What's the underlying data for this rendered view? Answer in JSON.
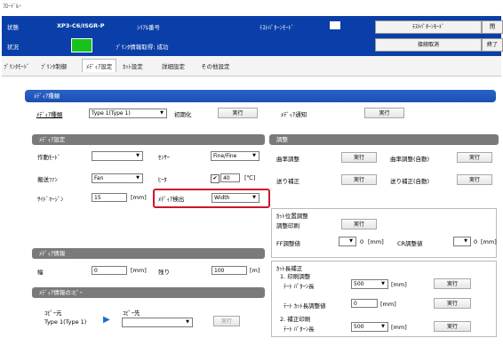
{
  "window": {
    "title": "ﾌﾛｰﾄﾞﾙｰ"
  },
  "header": {
    "row1_label": "状態",
    "model_name": "XP3-C6/ISGR-P",
    "serial_label": "ｼﾘｱﾙ番号",
    "mode_label": "ﾃｽﾄﾊﾟﾀｰﾝﾓｰﾄﾞ",
    "mode_button": "ﾃｽﾄﾊﾟﾀｰﾝﾓｰﾄﾞ",
    "close_button": "閉",
    "row2_label": "状況",
    "status_text": "ﾌﾟﾘﾝﾀ情報取得: 成功",
    "cancel_button": "接続取消",
    "exit_button": "終了",
    "status_color": "#16c21e"
  },
  "tabs": [
    "ﾌﾟﾘﾝﾀﾓｰﾄﾞ",
    "ﾌﾟﾘﾝﾀ制御",
    "ﾒﾃﾞｨｱ設定",
    "ｶｯﾄ設定",
    "詳細設定",
    "その他設定"
  ],
  "media_type": {
    "bar": "ﾒﾃﾞｨｱ種類",
    "label": "ﾒﾃﾞｨｱ種類",
    "value": "Type 1(Type 1)",
    "init_label": "初期化",
    "exec": "実行",
    "notify_label": "ﾒﾃﾞｨｱ通知",
    "exec2": "実行"
  },
  "media_settings": {
    "bar": "ﾒﾃﾞｨｱ設定",
    "mode_label": "作動ﾓｰﾄﾞ",
    "mode_value": "",
    "sensor_label": "ｾﾝｻｰ",
    "sensor_value": "Fine/Fine",
    "feed_label": "搬送ﾌｧﾝ",
    "feed_value": "Fan",
    "heater_label": "ﾋｰﾀ",
    "heater_value": "40",
    "heater_unit": "[℃]",
    "margin_label": "ｻｲﾄﾞﾏｰｼﾞﾝ",
    "margin_value": "15",
    "margin_unit": "[mm]",
    "detect_label": "ﾒﾃﾞｨｱ検出",
    "detect_value": "Width"
  },
  "adjust": {
    "bar": "調整",
    "row1_label": "曲率調整",
    "row1_exec": "実行",
    "row1_auto_label": "曲率調整(自動)",
    "row1_auto_exec": "実行",
    "row2_label": "送り補正",
    "row2_exec": "実行",
    "row2_auto_label": "送り補正(自動)",
    "row2_auto_exec": "実行"
  },
  "cut_position": {
    "title": "ｶｯﾄ位置調整",
    "row1_label": "調整印刷",
    "row1_exec": "実行",
    "ff_label": "FF調整値",
    "ff_value": "0",
    "ff_unit": "[mm]",
    "cr_label": "CR調整値",
    "cr_value": "0",
    "cr_unit": "[mm]"
  },
  "media_info": {
    "bar": "ﾒﾃﾞｨｱ情報",
    "width_label": "幅",
    "width_value": "0",
    "width_unit": "[mm]",
    "remain_label": "残り",
    "remain_value": "100",
    "remain_unit": "[m]"
  },
  "cut_correct": {
    "title": "ｶｯﾄ長補正",
    "s1_title": "1. 印刷調整",
    "s1_row_label": "ﾃｰﾄ ﾊﾟﾀｰﾝ長",
    "s1_row_value": "500",
    "s1_row_unit": "[mm]",
    "s1_exec": "実行",
    "s2_row_label": "ﾃｰﾄ ｶｯﾄ長調整値",
    "s2_row_value": "0",
    "s2_row_unit": "[mm]",
    "s2_exec": "実行",
    "s3_title": "2. 補正印刷",
    "s3_row_label": "ﾃｰﾄ ﾊﾟﾀｰﾝ長",
    "s3_row_value": "500",
    "s3_row_unit": "[mm]",
    "s3_exec": "実行"
  },
  "media_copy": {
    "bar": "ﾒﾃﾞｨｱ情報のｺﾋﾟｰ",
    "from_label": "ｺﾋﾟｰ元",
    "from_value": "Type 1(Type 1)",
    "to_label": "ｺﾋﾟｰ先",
    "to_value": "",
    "exec": "実行"
  }
}
